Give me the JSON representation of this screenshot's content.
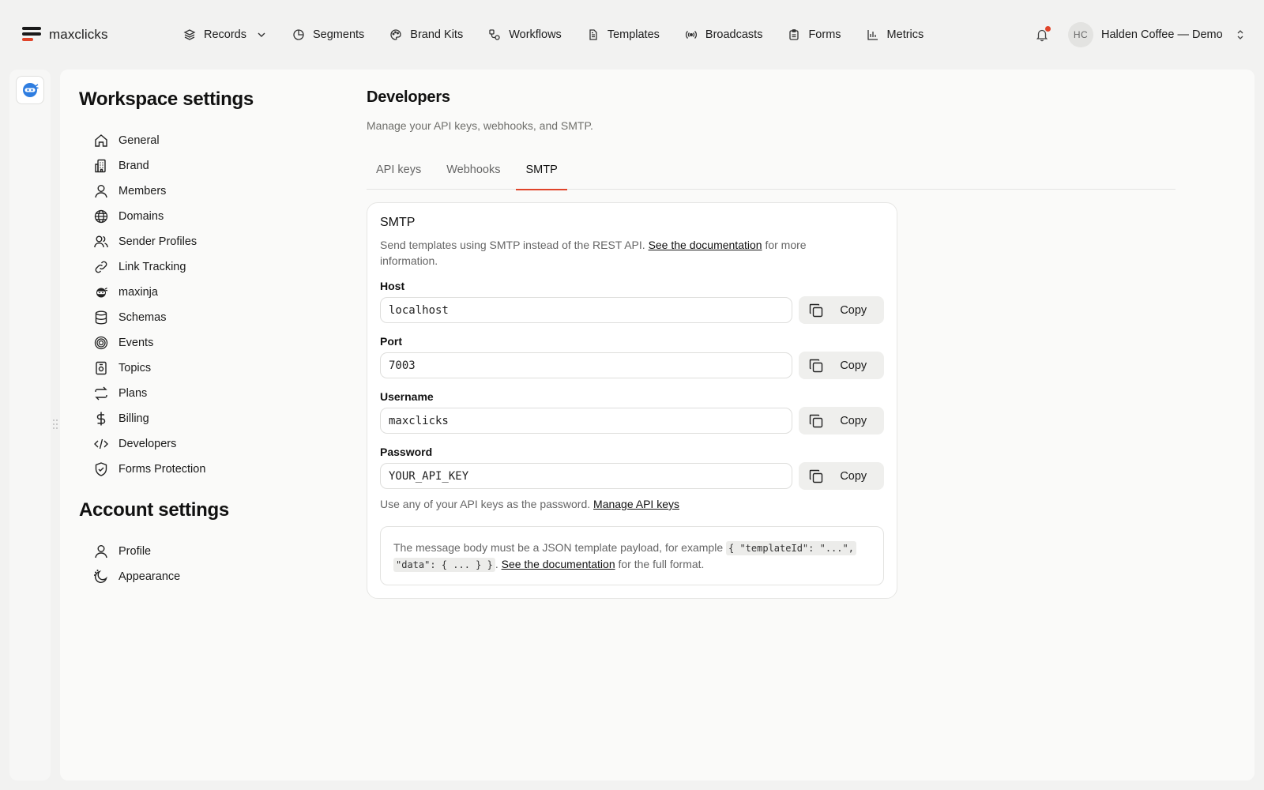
{
  "app": {
    "logo_text": "maxclicks",
    "brand_colors": {
      "red": "#e0442a",
      "dark": "#1a1a1a"
    }
  },
  "topnav": {
    "items": [
      {
        "label": "Records",
        "icon": "layers-icon",
        "has_dropdown": true
      },
      {
        "label": "Segments",
        "icon": "pie-chart-icon"
      },
      {
        "label": "Brand Kits",
        "icon": "palette-icon"
      },
      {
        "label": "Workflows",
        "icon": "workflow-icon"
      },
      {
        "label": "Templates",
        "icon": "document-icon"
      },
      {
        "label": "Broadcasts",
        "icon": "broadcast-icon"
      },
      {
        "label": "Forms",
        "icon": "clipboard-icon"
      },
      {
        "label": "Metrics",
        "icon": "bar-chart-icon"
      }
    ],
    "notifications_unread": true,
    "account": {
      "initials": "HC",
      "name": "Halden Coffee — Demo"
    }
  },
  "sidebar": {
    "workspace_title": "Workspace settings",
    "workspace_items": [
      {
        "label": "General",
        "icon": "home-icon"
      },
      {
        "label": "Brand",
        "icon": "building-icon"
      },
      {
        "label": "Members",
        "icon": "user-icon"
      },
      {
        "label": "Domains",
        "icon": "globe-icon"
      },
      {
        "label": "Sender Profiles",
        "icon": "users-icon"
      },
      {
        "label": "Link Tracking",
        "icon": "link-icon"
      },
      {
        "label": "maxinja",
        "icon": "ninja-icon"
      },
      {
        "label": "Schemas",
        "icon": "database-icon"
      },
      {
        "label": "Events",
        "icon": "target-icon"
      },
      {
        "label": "Topics",
        "icon": "topic-icon"
      },
      {
        "label": "Plans",
        "icon": "repeat-icon"
      },
      {
        "label": "Billing",
        "icon": "dollar-icon"
      },
      {
        "label": "Developers",
        "icon": "code-icon"
      },
      {
        "label": "Forms Protection",
        "icon": "shield-check-icon"
      }
    ],
    "account_title": "Account settings",
    "account_items": [
      {
        "label": "Profile",
        "icon": "user-icon"
      },
      {
        "label": "Appearance",
        "icon": "moon-icon"
      }
    ]
  },
  "page": {
    "title": "Developers",
    "subtitle": "Manage your API keys, webhooks, and SMTP.",
    "tabs": [
      {
        "label": "API keys",
        "active": false
      },
      {
        "label": "Webhooks",
        "active": false
      },
      {
        "label": "SMTP",
        "active": true
      }
    ]
  },
  "smtp": {
    "title": "SMTP",
    "desc_prefix": "Send templates using SMTP instead of the REST API.",
    "desc_link": "See the documentation",
    "desc_suffix": "for more information.",
    "copy_label": "Copy",
    "fields": [
      {
        "label": "Host",
        "value": "localhost"
      },
      {
        "label": "Port",
        "value": "7003"
      },
      {
        "label": "Username",
        "value": "maxclicks"
      },
      {
        "label": "Password",
        "value": "YOUR_API_KEY"
      }
    ],
    "hint_prefix": "Use any of your API keys as the password.",
    "hint_link": "Manage API keys",
    "notice_prefix": "The message body must be a JSON template payload, for example",
    "notice_code_1": "{ \"templateId\": \"...\",",
    "notice_code_2": "\"data\": { ... } }",
    "notice_link": "See the documentation",
    "notice_suffix": "for the full format."
  }
}
